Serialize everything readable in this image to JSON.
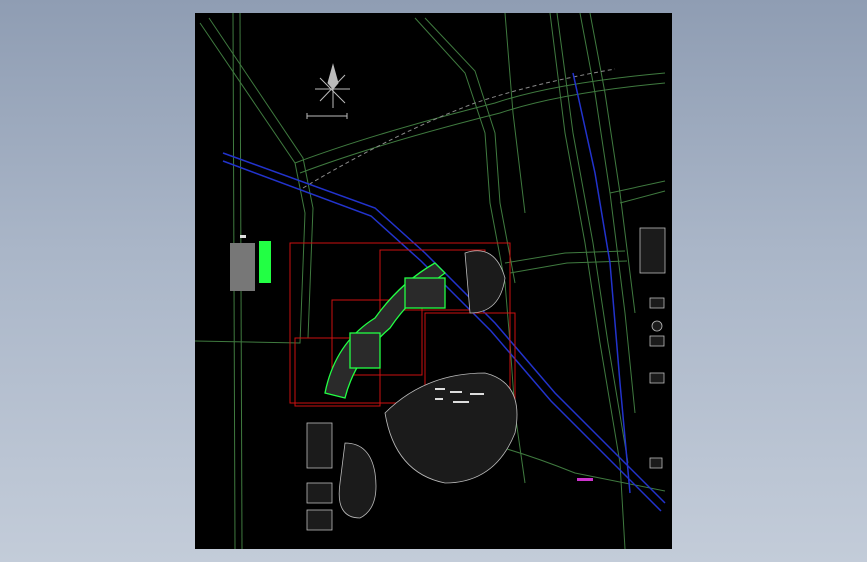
{
  "viewer": {
    "background_color": "#9aa7bb",
    "canvas_color": "#000000"
  },
  "drawing": {
    "kind": "CAD site plan",
    "colors": {
      "road": "#3f7a3f",
      "road_bright": "#6aa86a",
      "boundary_dashed": "#8a8a8a",
      "water_channel": "#2233cc",
      "frame": "#cc1111",
      "building": "#bbbbbb",
      "highlight": "#22ff44",
      "text_white": "#dddddd",
      "magenta": "#cc33cc"
    },
    "icons": [
      "north-arrow-icon",
      "scale-bar-icon"
    ]
  }
}
